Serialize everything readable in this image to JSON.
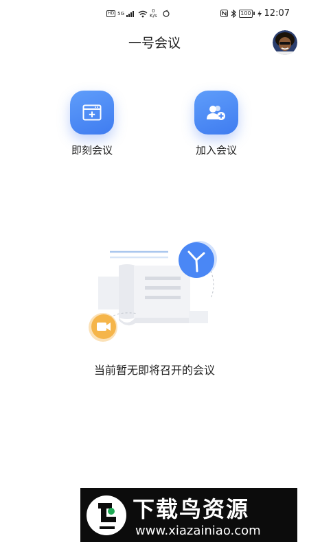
{
  "status_bar": {
    "hd": "HD",
    "network": "5G",
    "speed_value": "0",
    "speed_unit": "K/s",
    "battery": "100",
    "time": "12:07"
  },
  "header": {
    "title": "一号会议"
  },
  "actions": [
    {
      "label": "即刻会议",
      "icon": "new-meeting-icon"
    },
    {
      "label": "加入会议",
      "icon": "join-meeting-icon"
    }
  ],
  "empty_state": {
    "message": "当前暂无即将召开的会议"
  },
  "watermark": {
    "title": "下载鸟资源",
    "url": "www.xiazainiao.com"
  },
  "colors": {
    "accent": "#4a87f5",
    "video_badge": "#f5b54a"
  }
}
